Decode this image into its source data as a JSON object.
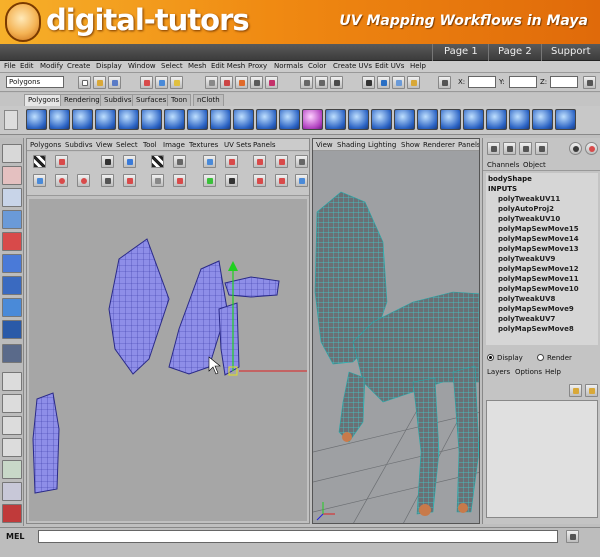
{
  "banner": {
    "brand": "digital-tutors",
    "course": "UV Mapping Workflows in Maya",
    "nav": [
      "Page 1",
      "Page 2",
      "Support"
    ]
  },
  "main_menu": [
    "File",
    "Edit",
    "Modify",
    "Create",
    "Display",
    "Window",
    "Select",
    "Mesh",
    "Edit Mesh",
    "Proxy",
    "Normals",
    "Color",
    "Create UVs",
    "Edit UVs",
    "Help"
  ],
  "status_line": {
    "mode": "Polygons",
    "x_label": "X:",
    "y_label": "Y:",
    "z_label": "Z:"
  },
  "shelf_tabs": [
    "Polygons",
    "Rendering",
    "Subdivs",
    "Surfaces",
    "Toon",
    "nCloth"
  ],
  "uv_editor": {
    "menu": [
      "Polygons",
      "Subdivs",
      "View",
      "Select",
      "Tool",
      "Image",
      "Textures",
      "UV Sets",
      "Panels"
    ]
  },
  "viewport": {
    "menu": [
      "View",
      "Shading",
      "Lighting",
      "Show",
      "Renderer",
      "Panels"
    ]
  },
  "channel_box": {
    "tabs": [
      "Channels",
      "Object"
    ],
    "node": "bodyShape",
    "inputs_label": "INPUTS",
    "history": [
      "polyTweakUV11",
      "polyAutoProj2",
      "polyTweakUV10",
      "polyMapSewMove15",
      "polyMapSewMove14",
      "polyMapSewMove13",
      "polyTweakUV9",
      "polyMapSewMove12",
      "polyMapSewMove11",
      "polyMapSewMove10",
      "polyTweakUV8",
      "polyMapSewMove9",
      "polyTweakUV7",
      "polyMapSewMove8"
    ]
  },
  "layers": {
    "display_label": "Display",
    "render_label": "Render",
    "menu": [
      "Layers",
      "Options",
      "Help"
    ]
  },
  "command_line": {
    "label": "MEL"
  },
  "colors": {
    "banner_orange": "#f08a12",
    "uv_shell": "#8c8ce8",
    "mesh_wire": "#3fd0d0"
  }
}
